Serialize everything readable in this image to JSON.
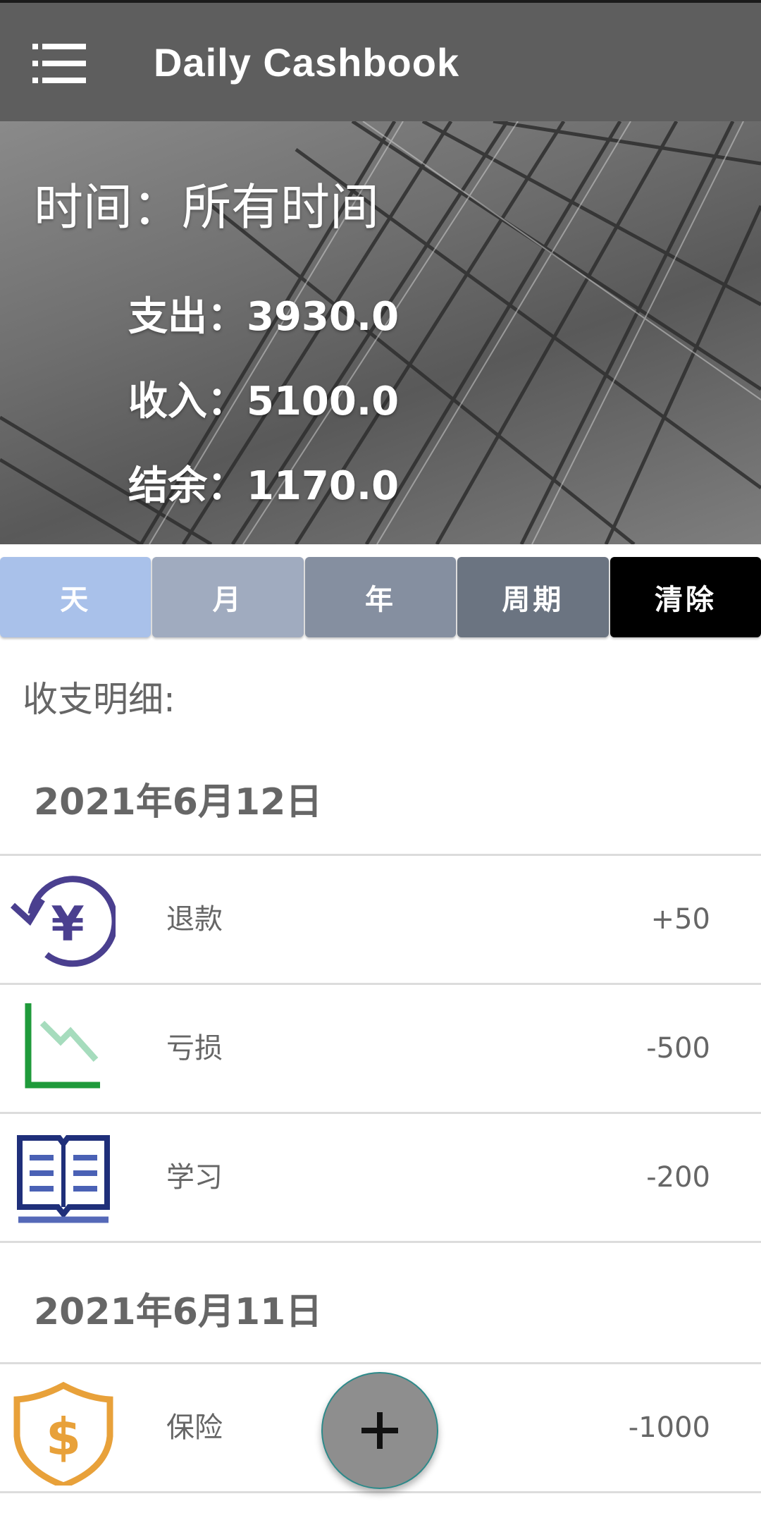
{
  "appbar": {
    "title": "Daily Cashbook",
    "menu_icon": "hamburger-menu-icon"
  },
  "summary": {
    "time_label": "时间：所有时间",
    "expense": "支出：3930.0",
    "income": "收入：5100.0",
    "balance": "结余：1170.0"
  },
  "tabs": [
    "天",
    "月",
    "年",
    "周期",
    "清除"
  ],
  "section_title": "收支明细:",
  "groups": [
    {
      "date": "2021年6月12日",
      "items": [
        {
          "name": "退款",
          "amount": "+50",
          "icon": "refund-yen-icon"
        },
        {
          "name": "亏损",
          "amount": "-500",
          "icon": "loss-chart-icon"
        },
        {
          "name": "学习",
          "amount": "-200",
          "icon": "study-book-icon"
        }
      ]
    },
    {
      "date": "2021年6月11日",
      "items": [
        {
          "name": "保险",
          "amount": "-1000",
          "icon": "insurance-shield-icon"
        }
      ]
    }
  ],
  "fab": {
    "icon": "plus-icon"
  },
  "colors": {
    "appbar": "#5e5e5e",
    "tab_day": "#a9c1ea",
    "tab_month": "#a0abbf",
    "tab_year": "#858fa0",
    "tab_period": "#6b7481",
    "tab_clear": "#000000"
  }
}
